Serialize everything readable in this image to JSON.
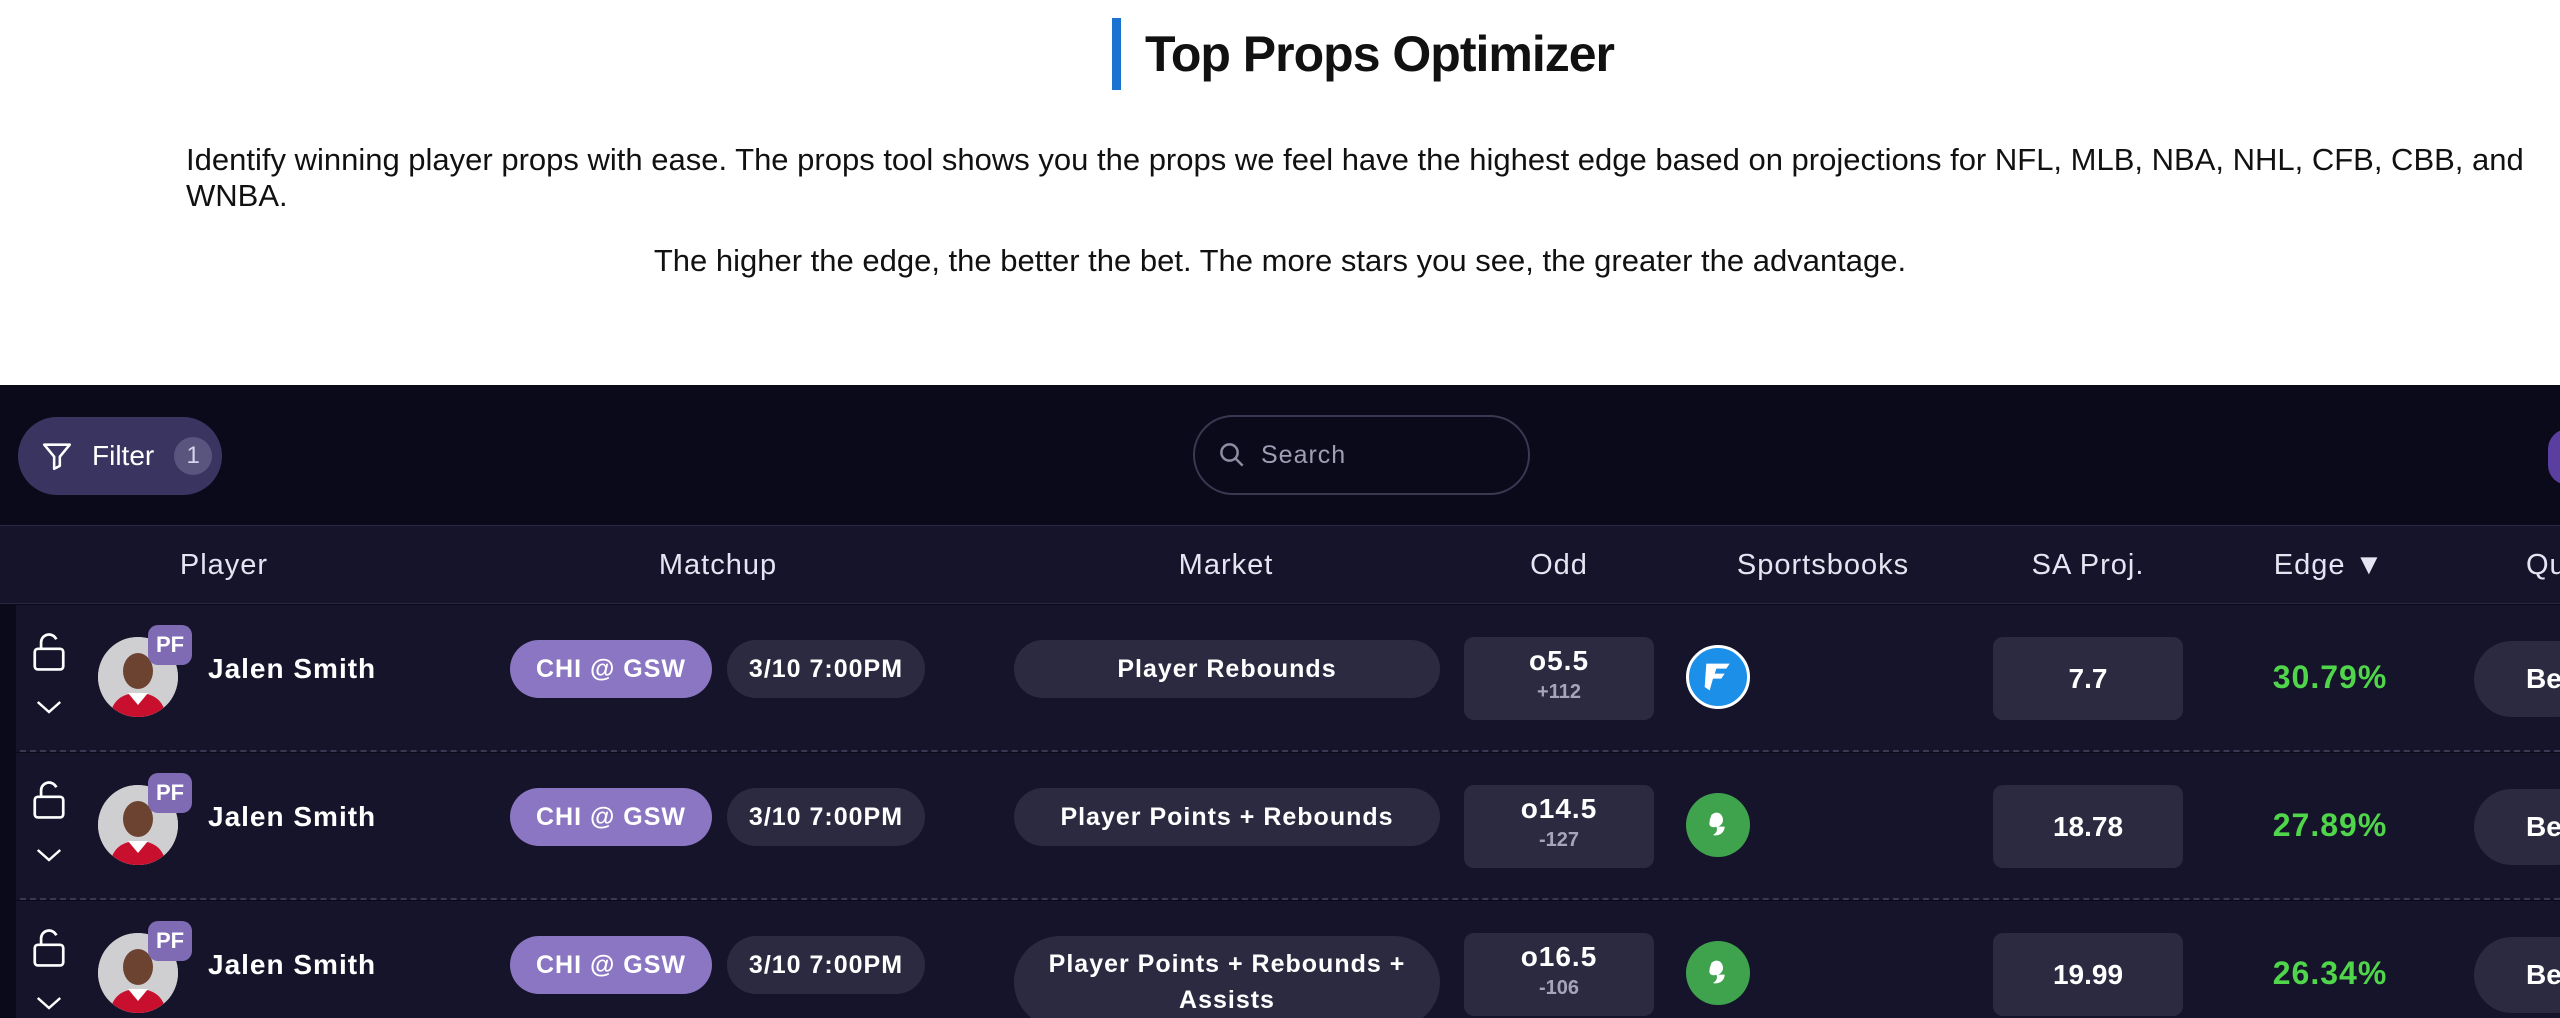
{
  "header": {
    "title": "Top Props Optimizer",
    "description_1": "Identify winning player props with ease. The props tool shows you the props we feel have the highest edge based on projections for NFL, MLB, NBA, NHL, CFB, CBB, and WNBA.",
    "description_2": "The higher the edge, the better the bet. The more stars you see, the greater the advantage."
  },
  "toolbar": {
    "filter_label": "Filter",
    "filter_count": "1",
    "search_placeholder": "Search"
  },
  "table": {
    "columns": [
      "Player",
      "Matchup",
      "Market",
      "Odd",
      "Sportsbooks",
      "SA Proj.",
      "Edge ▼",
      "Qu"
    ],
    "rows": [
      {
        "position": "PF",
        "player": "Jalen Smith",
        "matchup": "CHI @ GSW",
        "time": "3/10 7:00PM",
        "market": "Player Rebounds",
        "odd_line": "o5.5",
        "odd_price": "+112",
        "sportsbook_icon": "fanduel-icon",
        "projection": "7.7",
        "edge": "30.79%",
        "action": "Be"
      },
      {
        "position": "PF",
        "player": "Jalen Smith",
        "matchup": "CHI @ GSW",
        "time": "3/10 7:00PM",
        "market": "Player Points + Rebounds",
        "odd_line": "o14.5",
        "odd_price": "-127",
        "sportsbook_icon": "draftkings-icon",
        "projection": "18.78",
        "edge": "27.89%",
        "action": "Be"
      },
      {
        "position": "PF",
        "player": "Jalen Smith",
        "matchup": "CHI @ GSW",
        "time": "3/10 7:00PM",
        "market": "Player Points + Rebounds + Assists",
        "odd_line": "o16.5",
        "odd_price": "-106",
        "sportsbook_icon": "draftkings-icon",
        "projection": "19.99",
        "edge": "26.34%",
        "action": "Be"
      }
    ]
  },
  "colors": {
    "accent_bar": "#1a73d1",
    "panel_bg": "#0b0a1a",
    "row_bg": "#16142a",
    "matchup_pill": "#8a76c2",
    "edge_positive": "#4fd64a"
  }
}
